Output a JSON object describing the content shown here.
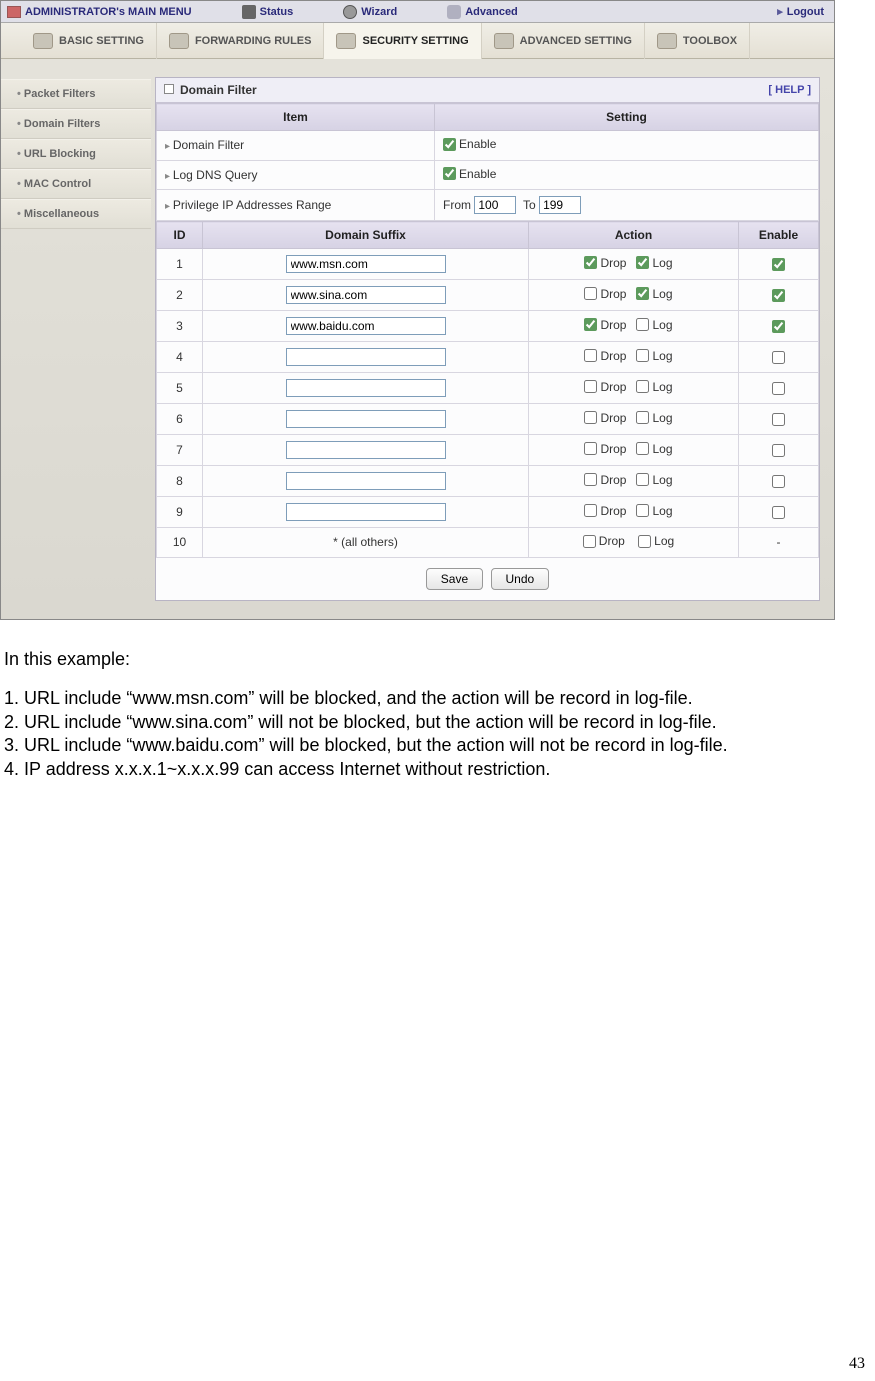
{
  "topbar": {
    "main": "ADMINISTRATOR's MAIN MENU",
    "status": "Status",
    "wizard": "Wizard",
    "advanced": "Advanced",
    "logout": "Logout"
  },
  "tabs": {
    "basic": "BASIC SETTING",
    "forward": "FORWARDING RULES",
    "security": "SECURITY SETTING",
    "advanced": "ADVANCED SETTING",
    "toolbox": "TOOLBOX"
  },
  "sidebar": {
    "items": [
      "Packet Filters",
      "Domain Filters",
      "URL Blocking",
      "MAC Control",
      "Miscellaneous"
    ]
  },
  "panel": {
    "title": "Domain Filter",
    "help": "[ HELP ]",
    "head_item": "Item",
    "head_setting": "Setting",
    "rows": {
      "domain_filter": "Domain Filter",
      "log_dns": "Log DNS Query",
      "priv_range": "Privilege IP Addresses Range",
      "from": "From",
      "to": "To",
      "from_val": "100",
      "to_val": "199",
      "enable": "Enable"
    },
    "grid": {
      "h_id": "ID",
      "h_domain": "Domain Suffix",
      "h_action": "Action",
      "h_enable": "Enable",
      "drop": "Drop",
      "log": "Log",
      "allothers": "* (all others)",
      "rows": [
        {
          "id": "1",
          "domain": "www.msn.com",
          "drop": true,
          "log": true,
          "enable": true
        },
        {
          "id": "2",
          "domain": "www.sina.com",
          "drop": false,
          "log": true,
          "enable": true
        },
        {
          "id": "3",
          "domain": "www.baidu.com",
          "drop": true,
          "log": false,
          "enable": true
        },
        {
          "id": "4",
          "domain": "",
          "drop": false,
          "log": false,
          "enable": false
        },
        {
          "id": "5",
          "domain": "",
          "drop": false,
          "log": false,
          "enable": false
        },
        {
          "id": "6",
          "domain": "",
          "drop": false,
          "log": false,
          "enable": false
        },
        {
          "id": "7",
          "domain": "",
          "drop": false,
          "log": false,
          "enable": false
        },
        {
          "id": "8",
          "domain": "",
          "drop": false,
          "log": false,
          "enable": false
        },
        {
          "id": "9",
          "domain": "",
          "drop": false,
          "log": false,
          "enable": false
        }
      ],
      "last_id": "10",
      "last_enable": "-"
    },
    "save": "Save",
    "undo": "Undo"
  },
  "doc": {
    "intro": "In this example:",
    "l1": "1. URL include “www.msn.com” will be blocked, and the action will be record in log-file.",
    "l2": "2. URL include “www.sina.com” will not be blocked, but the action will be record in log-file.",
    "l3": "3. URL include “www.baidu.com” will be blocked, but the action will not be record in log-file.",
    "l4": "4. IP address x.x.x.1~x.x.x.99 can access Internet without restriction."
  },
  "pagenum": "43"
}
